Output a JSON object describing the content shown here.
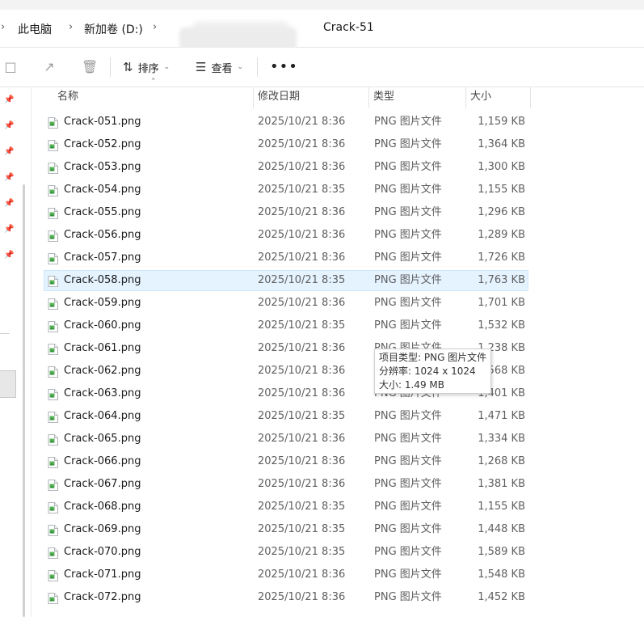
{
  "breadcrumb": {
    "items": [
      "此电脑",
      "新加卷 (D:)",
      "Crack-51"
    ]
  },
  "toolbar": {
    "sort_label": "排序",
    "view_label": "查看",
    "more_label": "•••"
  },
  "columns": {
    "name": "名称",
    "date": "修改日期",
    "type": "类型",
    "size": "大小"
  },
  "files": [
    {
      "name": "Crack-051.png",
      "date": "2025/10/21 8:36",
      "type": "PNG 图片文件",
      "size": "1,159 KB"
    },
    {
      "name": "Crack-052.png",
      "date": "2025/10/21 8:36",
      "type": "PNG 图片文件",
      "size": "1,364 KB"
    },
    {
      "name": "Crack-053.png",
      "date": "2025/10/21 8:36",
      "type": "PNG 图片文件",
      "size": "1,300 KB"
    },
    {
      "name": "Crack-054.png",
      "date": "2025/10/21 8:35",
      "type": "PNG 图片文件",
      "size": "1,155 KB"
    },
    {
      "name": "Crack-055.png",
      "date": "2025/10/21 8:36",
      "type": "PNG 图片文件",
      "size": "1,296 KB"
    },
    {
      "name": "Crack-056.png",
      "date": "2025/10/21 8:36",
      "type": "PNG 图片文件",
      "size": "1,289 KB"
    },
    {
      "name": "Crack-057.png",
      "date": "2025/10/21 8:36",
      "type": "PNG 图片文件",
      "size": "1,726 KB"
    },
    {
      "name": "Crack-058.png",
      "date": "2025/10/21 8:35",
      "type": "PNG 图片文件",
      "size": "1,763 KB",
      "selected": true
    },
    {
      "name": "Crack-059.png",
      "date": "2025/10/21 8:36",
      "type": "PNG 图片文件",
      "size": "1,701 KB"
    },
    {
      "name": "Crack-060.png",
      "date": "2025/10/21 8:35",
      "type": "PNG 图片文件",
      "size": "1,532 KB"
    },
    {
      "name": "Crack-061.png",
      "date": "2025/10/21 8:36",
      "type": "PNG 图片文件",
      "size": "1,238 KB"
    },
    {
      "name": "Crack-062.png",
      "date": "2025/10/21 8:36",
      "type": "PNG 图片文件",
      "size": "1,568 KB"
    },
    {
      "name": "Crack-063.png",
      "date": "2025/10/21 8:36",
      "type": "PNG 图片文件",
      "size": "1,401 KB"
    },
    {
      "name": "Crack-064.png",
      "date": "2025/10/21 8:35",
      "type": "PNG 图片文件",
      "size": "1,471 KB"
    },
    {
      "name": "Crack-065.png",
      "date": "2025/10/21 8:36",
      "type": "PNG 图片文件",
      "size": "1,334 KB"
    },
    {
      "name": "Crack-066.png",
      "date": "2025/10/21 8:36",
      "type": "PNG 图片文件",
      "size": "1,268 KB"
    },
    {
      "name": "Crack-067.png",
      "date": "2025/10/21 8:36",
      "type": "PNG 图片文件",
      "size": "1,381 KB"
    },
    {
      "name": "Crack-068.png",
      "date": "2025/10/21 8:35",
      "type": "PNG 图片文件",
      "size": "1,155 KB"
    },
    {
      "name": "Crack-069.png",
      "date": "2025/10/21 8:35",
      "type": "PNG 图片文件",
      "size": "1,448 KB"
    },
    {
      "name": "Crack-070.png",
      "date": "2025/10/21 8:35",
      "type": "PNG 图片文件",
      "size": "1,589 KB"
    },
    {
      "name": "Crack-071.png",
      "date": "2025/10/21 8:36",
      "type": "PNG 图片文件",
      "size": "1,548 KB"
    },
    {
      "name": "Crack-072.png",
      "date": "2025/10/21 8:36",
      "type": "PNG 图片文件",
      "size": "1,452 KB"
    }
  ],
  "tooltip": {
    "line1": "项目类型: PNG 图片文件",
    "line2": "分辨率: 1024 x 1024",
    "line3": "大小: 1.49 MB"
  },
  "icons": {
    "file": "png-image-file-icon",
    "pin": "pin-icon",
    "sort": "sort-arrows-icon",
    "view": "view-lines-icon"
  },
  "colors": {
    "selected_row": "#e5f3ff",
    "file_icon_green": "#5bb35b"
  }
}
